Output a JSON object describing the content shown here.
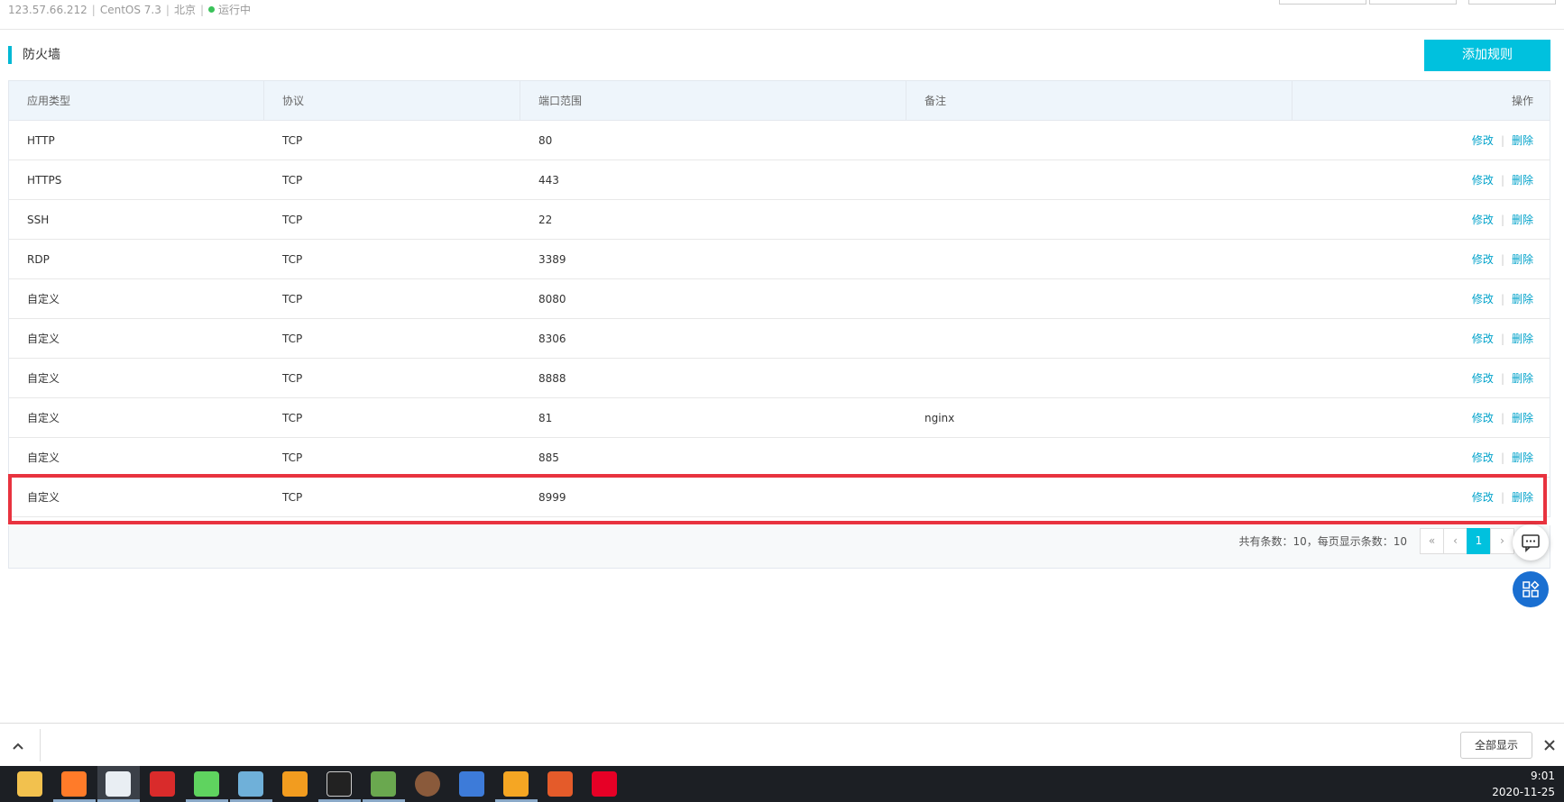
{
  "server": {
    "ip": "123.57.66.212",
    "os": "CentOS 7.3",
    "region": "北京",
    "status": "运行中",
    "separator": "|"
  },
  "section": {
    "title": "防火墙",
    "add_button": "添加规则"
  },
  "table": {
    "headers": [
      "应用类型",
      "协议",
      "端口范围",
      "备注",
      "操作"
    ],
    "rows": [
      {
        "type": "HTTP",
        "protocol": "TCP",
        "port": "80",
        "note": ""
      },
      {
        "type": "HTTPS",
        "protocol": "TCP",
        "port": "443",
        "note": ""
      },
      {
        "type": "SSH",
        "protocol": "TCP",
        "port": "22",
        "note": ""
      },
      {
        "type": "RDP",
        "protocol": "TCP",
        "port": "3389",
        "note": ""
      },
      {
        "type": "自定义",
        "protocol": "TCP",
        "port": "8080",
        "note": ""
      },
      {
        "type": "自定义",
        "protocol": "TCP",
        "port": "8306",
        "note": ""
      },
      {
        "type": "自定义",
        "protocol": "TCP",
        "port": "8888",
        "note": ""
      },
      {
        "type": "自定义",
        "protocol": "TCP",
        "port": "81",
        "note": "nginx"
      },
      {
        "type": "自定义",
        "protocol": "TCP",
        "port": "885",
        "note": ""
      },
      {
        "type": "自定义",
        "protocol": "TCP",
        "port": "8999",
        "note": ""
      }
    ],
    "actions": {
      "edit": "修改",
      "delete": "删除",
      "separator": "|"
    }
  },
  "pagination": {
    "summary": "共有条数：10，每页显示条数：10",
    "first": "«",
    "prev": "‹",
    "current": "1",
    "next": "›"
  },
  "download_bar": {
    "show_all": "全部显示"
  },
  "taskbar": {
    "time": "9:01",
    "date": "2020-11-25",
    "apps": [
      "file-explorer-icon",
      "firefox-icon",
      "chrome-icon",
      "youdao-icon",
      "wechat-icon",
      "notepad-icon",
      "app-icon",
      "terminal-icon",
      "money-app-icon",
      "avatar-app-icon",
      "calculator-icon",
      "virtualbox-icon",
      "snail-app-icon",
      "netease-music-icon"
    ]
  },
  "colors": {
    "accent": "#00c1de",
    "link": "#00a2ca",
    "highlight": "#e8333f",
    "status_dot": "#3ac25a"
  }
}
